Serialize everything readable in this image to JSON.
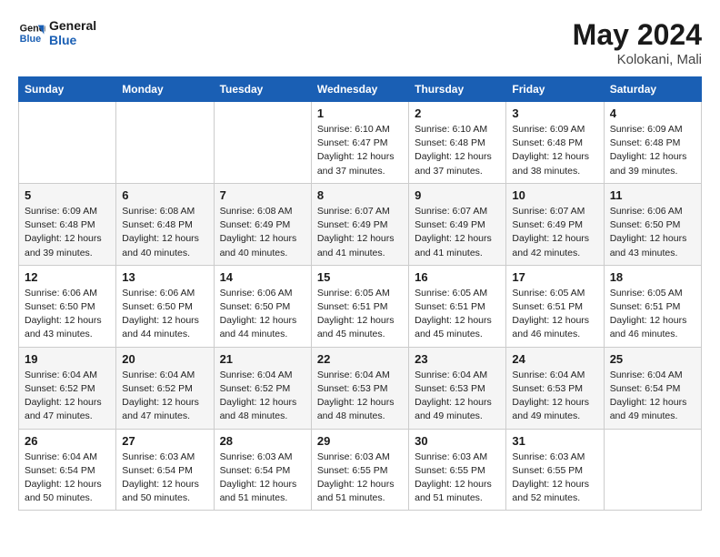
{
  "logo": {
    "line1": "General",
    "line2": "Blue"
  },
  "title": "May 2024",
  "subtitle": "Kolokani, Mali",
  "days_header": [
    "Sunday",
    "Monday",
    "Tuesday",
    "Wednesday",
    "Thursday",
    "Friday",
    "Saturday"
  ],
  "weeks": [
    [
      {
        "num": "",
        "info": ""
      },
      {
        "num": "",
        "info": ""
      },
      {
        "num": "",
        "info": ""
      },
      {
        "num": "1",
        "info": "Sunrise: 6:10 AM\nSunset: 6:47 PM\nDaylight: 12 hours\nand 37 minutes."
      },
      {
        "num": "2",
        "info": "Sunrise: 6:10 AM\nSunset: 6:48 PM\nDaylight: 12 hours\nand 37 minutes."
      },
      {
        "num": "3",
        "info": "Sunrise: 6:09 AM\nSunset: 6:48 PM\nDaylight: 12 hours\nand 38 minutes."
      },
      {
        "num": "4",
        "info": "Sunrise: 6:09 AM\nSunset: 6:48 PM\nDaylight: 12 hours\nand 39 minutes."
      }
    ],
    [
      {
        "num": "5",
        "info": "Sunrise: 6:09 AM\nSunset: 6:48 PM\nDaylight: 12 hours\nand 39 minutes."
      },
      {
        "num": "6",
        "info": "Sunrise: 6:08 AM\nSunset: 6:48 PM\nDaylight: 12 hours\nand 40 minutes."
      },
      {
        "num": "7",
        "info": "Sunrise: 6:08 AM\nSunset: 6:49 PM\nDaylight: 12 hours\nand 40 minutes."
      },
      {
        "num": "8",
        "info": "Sunrise: 6:07 AM\nSunset: 6:49 PM\nDaylight: 12 hours\nand 41 minutes."
      },
      {
        "num": "9",
        "info": "Sunrise: 6:07 AM\nSunset: 6:49 PM\nDaylight: 12 hours\nand 41 minutes."
      },
      {
        "num": "10",
        "info": "Sunrise: 6:07 AM\nSunset: 6:49 PM\nDaylight: 12 hours\nand 42 minutes."
      },
      {
        "num": "11",
        "info": "Sunrise: 6:06 AM\nSunset: 6:50 PM\nDaylight: 12 hours\nand 43 minutes."
      }
    ],
    [
      {
        "num": "12",
        "info": "Sunrise: 6:06 AM\nSunset: 6:50 PM\nDaylight: 12 hours\nand 43 minutes."
      },
      {
        "num": "13",
        "info": "Sunrise: 6:06 AM\nSunset: 6:50 PM\nDaylight: 12 hours\nand 44 minutes."
      },
      {
        "num": "14",
        "info": "Sunrise: 6:06 AM\nSunset: 6:50 PM\nDaylight: 12 hours\nand 44 minutes."
      },
      {
        "num": "15",
        "info": "Sunrise: 6:05 AM\nSunset: 6:51 PM\nDaylight: 12 hours\nand 45 minutes."
      },
      {
        "num": "16",
        "info": "Sunrise: 6:05 AM\nSunset: 6:51 PM\nDaylight: 12 hours\nand 45 minutes."
      },
      {
        "num": "17",
        "info": "Sunrise: 6:05 AM\nSunset: 6:51 PM\nDaylight: 12 hours\nand 46 minutes."
      },
      {
        "num": "18",
        "info": "Sunrise: 6:05 AM\nSunset: 6:51 PM\nDaylight: 12 hours\nand 46 minutes."
      }
    ],
    [
      {
        "num": "19",
        "info": "Sunrise: 6:04 AM\nSunset: 6:52 PM\nDaylight: 12 hours\nand 47 minutes."
      },
      {
        "num": "20",
        "info": "Sunrise: 6:04 AM\nSunset: 6:52 PM\nDaylight: 12 hours\nand 47 minutes."
      },
      {
        "num": "21",
        "info": "Sunrise: 6:04 AM\nSunset: 6:52 PM\nDaylight: 12 hours\nand 48 minutes."
      },
      {
        "num": "22",
        "info": "Sunrise: 6:04 AM\nSunset: 6:53 PM\nDaylight: 12 hours\nand 48 minutes."
      },
      {
        "num": "23",
        "info": "Sunrise: 6:04 AM\nSunset: 6:53 PM\nDaylight: 12 hours\nand 49 minutes."
      },
      {
        "num": "24",
        "info": "Sunrise: 6:04 AM\nSunset: 6:53 PM\nDaylight: 12 hours\nand 49 minutes."
      },
      {
        "num": "25",
        "info": "Sunrise: 6:04 AM\nSunset: 6:54 PM\nDaylight: 12 hours\nand 49 minutes."
      }
    ],
    [
      {
        "num": "26",
        "info": "Sunrise: 6:04 AM\nSunset: 6:54 PM\nDaylight: 12 hours\nand 50 minutes."
      },
      {
        "num": "27",
        "info": "Sunrise: 6:03 AM\nSunset: 6:54 PM\nDaylight: 12 hours\nand 50 minutes."
      },
      {
        "num": "28",
        "info": "Sunrise: 6:03 AM\nSunset: 6:54 PM\nDaylight: 12 hours\nand 51 minutes."
      },
      {
        "num": "29",
        "info": "Sunrise: 6:03 AM\nSunset: 6:55 PM\nDaylight: 12 hours\nand 51 minutes."
      },
      {
        "num": "30",
        "info": "Sunrise: 6:03 AM\nSunset: 6:55 PM\nDaylight: 12 hours\nand 51 minutes."
      },
      {
        "num": "31",
        "info": "Sunrise: 6:03 AM\nSunset: 6:55 PM\nDaylight: 12 hours\nand 52 minutes."
      },
      {
        "num": "",
        "info": ""
      }
    ]
  ]
}
